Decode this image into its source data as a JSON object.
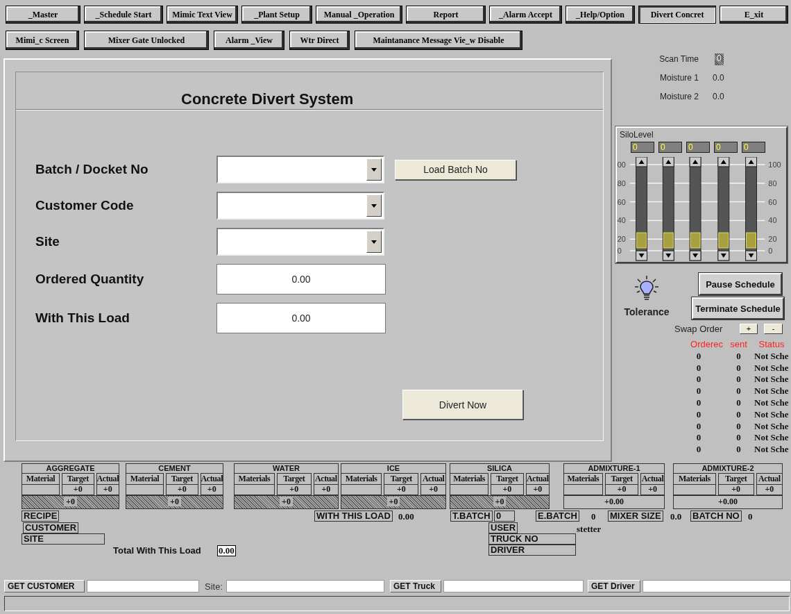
{
  "toolbar_row_1": [
    {
      "label": "_Master",
      "selected": false
    },
    {
      "label": "_Schedule Start",
      "selected": false
    },
    {
      "label": "Mimic Text View",
      "selected": false
    },
    {
      "label": "_Plant Setup",
      "selected": false
    },
    {
      "label": "Manual _Operation",
      "selected": false
    },
    {
      "label": "Report",
      "selected": false
    },
    {
      "label": "_Alarm Accept",
      "selected": false
    },
    {
      "label": "_Help/Option",
      "selected": false
    },
    {
      "label": "Divert Concret",
      "selected": true
    },
    {
      "label": "E_xit",
      "selected": false
    }
  ],
  "toolbar_row_2": [
    {
      "label": "Mimi_c Screen",
      "selected": false
    },
    {
      "label": "Mixer Gate Unlocked",
      "selected": false
    },
    {
      "label": "Alarm _View",
      "selected": false
    },
    {
      "label": "Wtr Direct",
      "selected": false
    },
    {
      "label": "Maintanance Message Vie_w Disable",
      "selected": false
    }
  ],
  "form": {
    "title": "Concrete Divert System",
    "fields": [
      {
        "label": "Batch / Docket No",
        "kind": "dropdown"
      },
      {
        "label": "Customer Code",
        "kind": "dropdown"
      },
      {
        "label": "Site",
        "kind": "dropdown"
      },
      {
        "label": "Ordered Quantity",
        "kind": "number",
        "value": "0.00"
      },
      {
        "label": "With This Load",
        "kind": "number",
        "value": "0.00"
      }
    ],
    "load_button": "Load Batch No",
    "divert_button": "Divert Now"
  },
  "readings": [
    {
      "label": "Scan Time",
      "value": "0",
      "kind": "indicator"
    },
    {
      "label": "Moisture 1",
      "value": "0.0",
      "kind": "text"
    },
    {
      "label": "Moisture 2",
      "value": "0.0",
      "kind": "text"
    }
  ],
  "silo_level": {
    "title": "SiloLevel",
    "left_scale": [
      "00",
      "80",
      "60",
      "40",
      "20",
      "0"
    ],
    "right_scale": [
      "100",
      "80",
      "60",
      "40",
      "20",
      "0"
    ],
    "silos": [
      {
        "reading": "0",
        "level": 0.1
      },
      {
        "reading": "0",
        "level": 0.1
      },
      {
        "reading": "0",
        "level": 0.1
      },
      {
        "reading": "0",
        "level": 0.1
      },
      {
        "reading": "0",
        "level": 0.1
      }
    ]
  },
  "tolerance": {
    "label": "Tolerance"
  },
  "schedule_buttons": [
    "Pause Schedule",
    "Terminate Schedule"
  ],
  "swap_order": {
    "label": "Swap Order",
    "buttons": [
      "+",
      "-"
    ]
  },
  "orders": {
    "columns": [
      "Orderec",
      "sent",
      "Status"
    ],
    "rows": [
      [
        "0",
        "0",
        "Not Sche"
      ],
      [
        "0",
        "0",
        "Not Sche"
      ],
      [
        "0",
        "0",
        "Not Sche"
      ],
      [
        "0",
        "0",
        "Not Sche"
      ],
      [
        "0",
        "0",
        "Not Sche"
      ],
      [
        "0",
        "0",
        "Not Sche"
      ],
      [
        "0",
        "0",
        "Not Sche"
      ],
      [
        "0",
        "0",
        "Not Sche"
      ],
      [
        "0",
        "0",
        "Not Sche"
      ]
    ]
  },
  "materials": [
    {
      "name": "AGGREGATE",
      "columns": [
        "Material",
        "Target",
        "Actual"
      ],
      "target": "+0",
      "actual": "+0",
      "total": "+0",
      "kind": "hatched"
    },
    {
      "name": "CEMENT",
      "columns": [
        "Material",
        "Target",
        "Actual"
      ],
      "target": "+0",
      "actual": "+0",
      "total": "+0",
      "kind": "hatched"
    },
    {
      "name": "WATER",
      "columns": [
        "Materials",
        "Target",
        "Actual"
      ],
      "target": "+0",
      "actual": "+0",
      "total": "+0",
      "kind": "hatched"
    },
    {
      "name": "ICE",
      "columns": [
        "Materials",
        "Target",
        "Actual"
      ],
      "target": "+0",
      "actual": "+0",
      "total": "+0",
      "kind": "hatched"
    },
    {
      "name": "SILICA",
      "columns": [
        "Materials",
        "Target",
        "Actual"
      ],
      "target": "+0",
      "actual": "+0",
      "total": "+0",
      "kind": "hatched"
    },
    {
      "name": "ADMIXTURE-1",
      "columns": [
        "Materials",
        "Target",
        "Actual"
      ],
      "target": "+0",
      "actual": "+0",
      "total": "+0.00",
      "kind": "plain"
    },
    {
      "name": "ADMIXTURE-2",
      "columns": [
        "Materials",
        "Target",
        "Actual"
      ],
      "target": "+0",
      "actual": "+0",
      "total": "+0.00",
      "kind": "plain"
    }
  ],
  "summary": {
    "recipe": "RECIPE",
    "customer": "CUSTOMER",
    "site": "SITE",
    "total_label": "Total With This Load",
    "total_value": "0.00",
    "with_this_load_label": "WITH THIS LOAD",
    "with_this_load_value": "0.00",
    "t_batch_label": "T.BATCH",
    "t_batch_value": "0",
    "e_batch_label": "E.BATCH",
    "e_batch_value": "0",
    "mixer_size_label": "MIXER SIZE",
    "mixer_size_value": "0.0",
    "batch_no_label": "BATCH NO",
    "batch_no_value": "0",
    "user_label": "USER",
    "user_value": "stetter",
    "truck_label": "TRUCK NO",
    "driver_label": "DRIVER"
  },
  "bottom_bar": {
    "customer_button": "GET CUSTOMER",
    "site_label": "Site:",
    "truck_button": "GET Truck",
    "driver_button": "GET Driver"
  }
}
